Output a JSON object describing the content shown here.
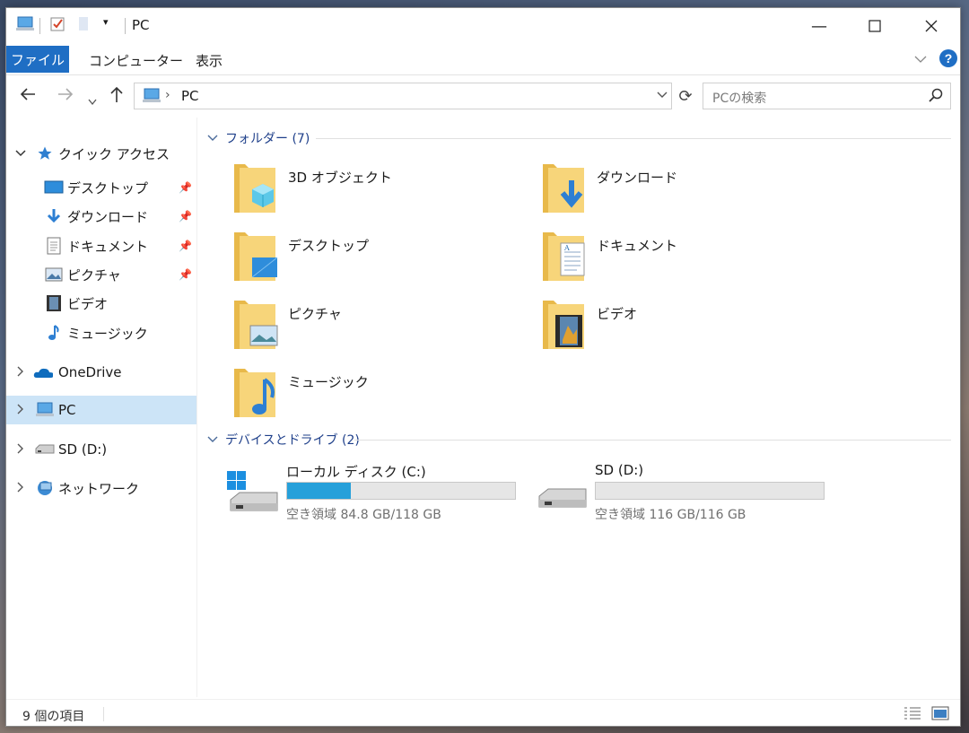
{
  "window": {
    "title": "PC"
  },
  "ribbon": {
    "tabs": [
      "ファイル",
      "コンピューター",
      "表示"
    ]
  },
  "nav": {
    "address_label": "PC",
    "search_placeholder": "PCの検索"
  },
  "sidebar": {
    "quick_access": "クイック アクセス",
    "quick_items": [
      {
        "label": "デスクトップ",
        "icon": "desktop-icon",
        "pinned": true
      },
      {
        "label": "ダウンロード",
        "icon": "download-icon",
        "pinned": true
      },
      {
        "label": "ドキュメント",
        "icon": "document-icon",
        "pinned": true
      },
      {
        "label": "ピクチャ",
        "icon": "pictures-icon",
        "pinned": true
      },
      {
        "label": "ビデオ",
        "icon": "video-icon",
        "pinned": false
      },
      {
        "label": "ミュージック",
        "icon": "music-icon",
        "pinned": false
      }
    ],
    "onedrive": "OneDrive",
    "pc": "PC",
    "sd": "SD (D:)",
    "network": "ネットワーク"
  },
  "content": {
    "folders_header": "フォルダー (7)",
    "folders": [
      {
        "name": "3D オブジェクト",
        "icon": "3d-objects-icon"
      },
      {
        "name": "ダウンロード",
        "icon": "download-icon"
      },
      {
        "name": "デスクトップ",
        "icon": "desktop-icon"
      },
      {
        "name": "ドキュメント",
        "icon": "document-icon"
      },
      {
        "name": "ピクチャ",
        "icon": "pictures-icon"
      },
      {
        "name": "ビデオ",
        "icon": "video-icon"
      },
      {
        "name": "ミュージック",
        "icon": "music-icon"
      }
    ],
    "devices_header": "デバイスとドライブ (2)",
    "drives": [
      {
        "name": "ローカル ディスク (C:)",
        "free_text": "空き領域 84.8 GB/118 GB",
        "used_fraction": 0.28,
        "color": "#26a0da"
      },
      {
        "name": "SD (D:)",
        "free_text": "空き領域 116 GB/116 GB",
        "used_fraction": 0.0,
        "color": "#26a0da"
      }
    ]
  },
  "status": {
    "item_count": "9 個の項目"
  },
  "colors": {
    "accent": "#1f6ec4",
    "selection": "#cce4f7",
    "bar": "#26a0da"
  }
}
